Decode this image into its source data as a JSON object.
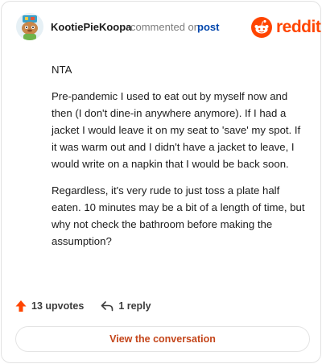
{
  "header": {
    "username": "KootiePieKoopa",
    "action_text": "commented on",
    "post_link": "post",
    "brand_name": "reddit",
    "brand_color": "#ff4500"
  },
  "comment": {
    "paragraphs": [
      "NTA",
      "Pre-pandemic I used to eat out by myself now and then (I don't dine-in anywhere anymore). If I had a jacket I would leave it on my seat to 'save' my spot. If it was warm out and I didn't have a jacket to leave, I would write on a napkin that I would be back soon.",
      "Regardless, it's very rude to just toss a plate half eaten. 10 minutes may be a bit of a length of time, but why not check the bathroom before making the assumption?"
    ]
  },
  "actions": {
    "upvotes_label": "13 upvotes",
    "upvote_icon": "upvote-arrow-icon",
    "upvote_color": "#ff4500",
    "reply_label": "1 reply",
    "reply_icon": "reply-arrow-icon"
  },
  "footer": {
    "view_button_label": "View the conversation",
    "view_button_color": "#c4451a"
  },
  "icons": {
    "avatar": "snoo-avatar-icon",
    "brand_logo": "reddit-snoo-logo-icon"
  }
}
